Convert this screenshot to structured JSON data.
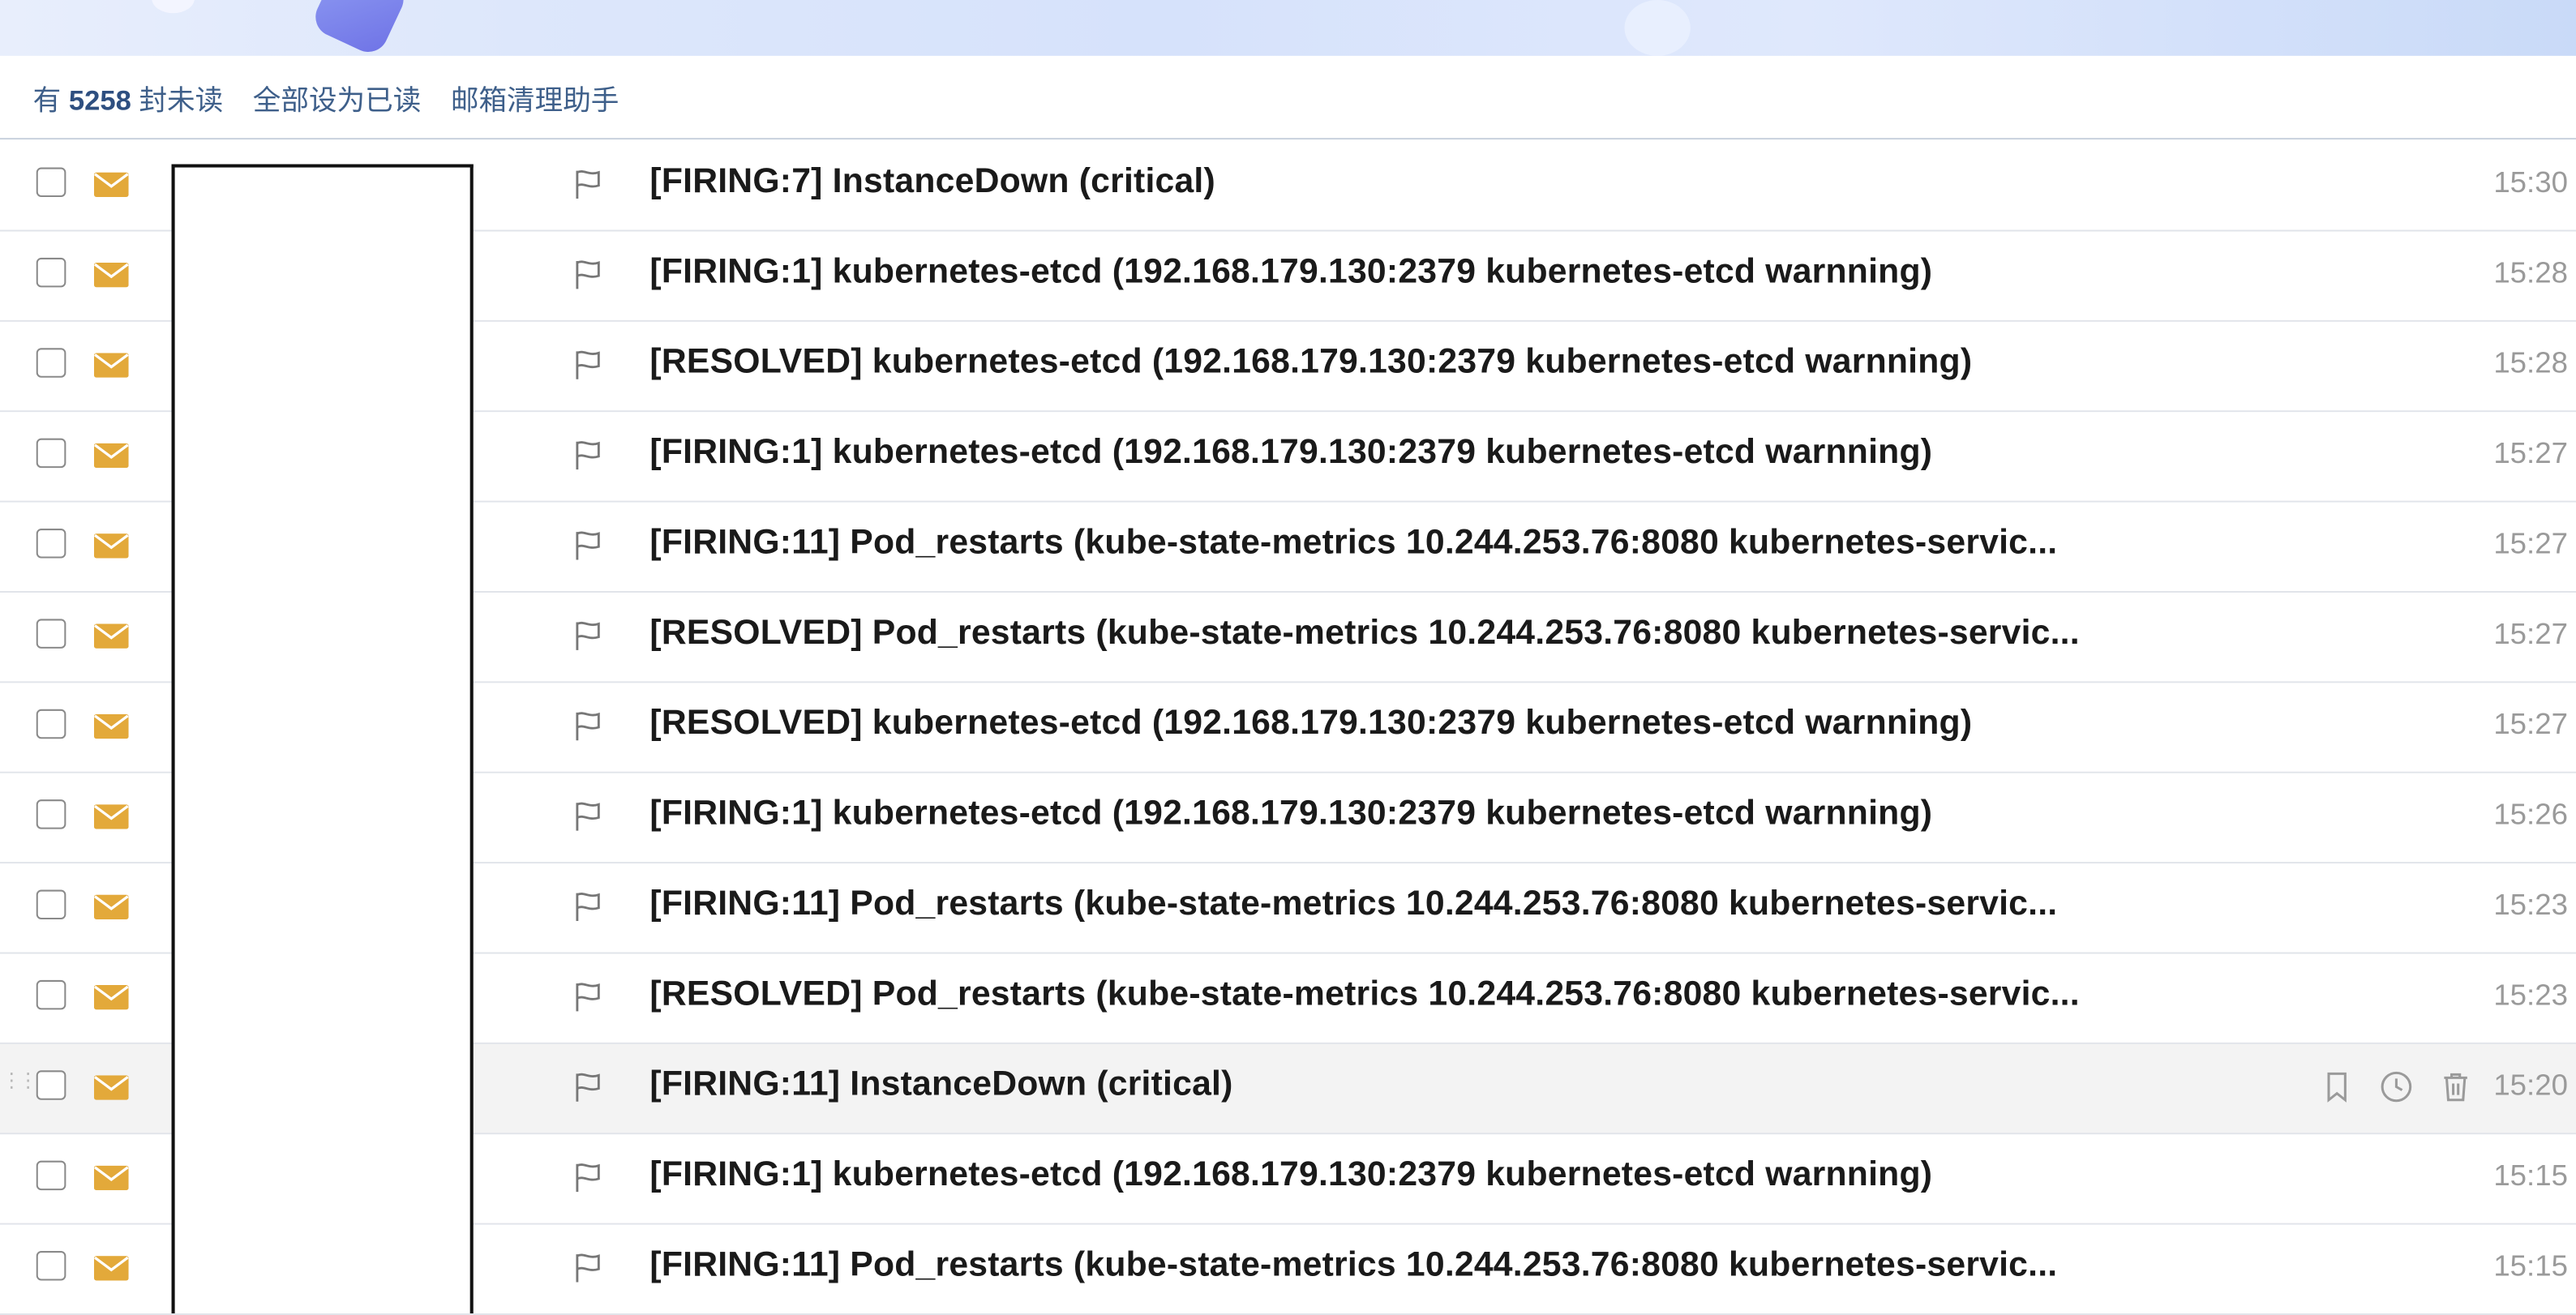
{
  "toolbar": {
    "unread_prefix": "有",
    "unread_count": "5258",
    "unread_suffix": "封未读",
    "mark_all_read": "全部设为已读",
    "cleanup_helper": "邮箱清理助手"
  },
  "colors": {
    "envelope": "#e3a93a",
    "toolbar_text": "#3e5f8a",
    "time_text": "#9a9a9a",
    "hover_row": "#f3f3f3"
  },
  "emails": [
    {
      "subject": "[FIRING:7] InstanceDown (critical)",
      "time": "15:30"
    },
    {
      "subject": "[FIRING:1] kubernetes-etcd (192.168.179.130:2379 kubernetes-etcd warnning)",
      "time": "15:28"
    },
    {
      "subject": "[RESOLVED] kubernetes-etcd (192.168.179.130:2379 kubernetes-etcd warnning)",
      "time": "15:28"
    },
    {
      "subject": "[FIRING:1] kubernetes-etcd (192.168.179.130:2379 kubernetes-etcd warnning)",
      "time": "15:27"
    },
    {
      "subject": "[FIRING:11] Pod_restarts (kube-state-metrics 10.244.253.76:8080 kubernetes-servic...",
      "time": "15:27"
    },
    {
      "subject": "[RESOLVED] Pod_restarts (kube-state-metrics 10.244.253.76:8080 kubernetes-servic...",
      "time": "15:27"
    },
    {
      "subject": "[RESOLVED] kubernetes-etcd (192.168.179.130:2379 kubernetes-etcd warnning)",
      "time": "15:27"
    },
    {
      "subject": "[FIRING:1] kubernetes-etcd (192.168.179.130:2379 kubernetes-etcd warnning)",
      "time": "15:26"
    },
    {
      "subject": "[FIRING:11] Pod_restarts (kube-state-metrics 10.244.253.76:8080 kubernetes-servic...",
      "time": "15:23"
    },
    {
      "subject": "[RESOLVED] Pod_restarts (kube-state-metrics 10.244.253.76:8080 kubernetes-servic...",
      "time": "15:23"
    },
    {
      "subject": "[FIRING:11] InstanceDown (critical)",
      "time": "15:20",
      "hovered": true
    },
    {
      "subject": "[FIRING:1] kubernetes-etcd (192.168.179.130:2379 kubernetes-etcd warnning)",
      "time": "15:15"
    },
    {
      "subject": "[FIRING:11] Pod_restarts (kube-state-metrics 10.244.253.76:8080 kubernetes-servic...",
      "time": "15:15"
    }
  ],
  "row_action_icons": [
    "bookmark-icon",
    "clock-icon",
    "trash-icon"
  ]
}
